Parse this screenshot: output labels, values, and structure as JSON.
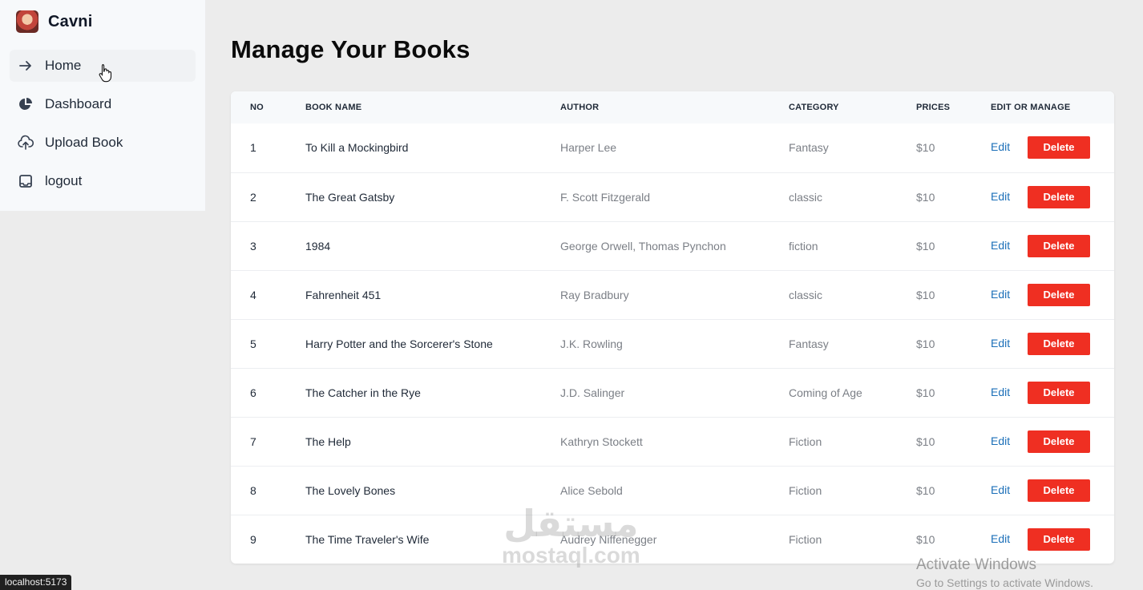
{
  "brand": {
    "name": "Cavni"
  },
  "sidebar": {
    "items": [
      {
        "label": "Home",
        "icon": "arrow-right-icon",
        "active": true
      },
      {
        "label": "Dashboard",
        "icon": "pie-chart-icon",
        "active": false
      },
      {
        "label": "Upload Book",
        "icon": "cloud-upload-icon",
        "active": false
      },
      {
        "label": "logout",
        "icon": "inbox-icon",
        "active": false
      }
    ]
  },
  "page": {
    "title": "Manage Your Books"
  },
  "table": {
    "headers": [
      "NO",
      "BOOK NAME",
      "AUTHOR",
      "CATEGORY",
      "PRICES",
      "EDIT OR MANAGE"
    ],
    "edit_label": "Edit",
    "delete_label": "Delete",
    "rows": [
      {
        "no": "1",
        "name": "To Kill a Mockingbird",
        "author": "Harper Lee",
        "category": "Fantasy",
        "price": "$10"
      },
      {
        "no": "2",
        "name": "The Great Gatsby",
        "author": "F. Scott Fitzgerald",
        "category": "classic",
        "price": "$10"
      },
      {
        "no": "3",
        "name": "1984",
        "author": "George Orwell, Thomas Pynchon",
        "category": "fiction",
        "price": "$10"
      },
      {
        "no": "4",
        "name": "Fahrenheit 451",
        "author": "Ray Bradbury",
        "category": "classic",
        "price": "$10"
      },
      {
        "no": "5",
        "name": "Harry Potter and the Sorcerer's Stone",
        "author": "J.K. Rowling",
        "category": "Fantasy",
        "price": "$10"
      },
      {
        "no": "6",
        "name": "The Catcher in the Rye",
        "author": "J.D. Salinger",
        "category": "Coming of Age",
        "price": "$10"
      },
      {
        "no": "7",
        "name": "The Help",
        "author": "Kathryn Stockett",
        "category": "Fiction",
        "price": "$10"
      },
      {
        "no": "8",
        "name": "The Lovely Bones",
        "author": "Alice Sebold",
        "category": "Fiction",
        "price": "$10"
      },
      {
        "no": "9",
        "name": "The Time Traveler's Wife",
        "author": "Audrey Niffenegger",
        "category": "Fiction",
        "price": "$10"
      }
    ]
  },
  "status_bar": {
    "url": "localhost:5173"
  },
  "watermark": {
    "arabic": "مستقل",
    "latin": "mostaql.com"
  },
  "os_notice": {
    "line1": "Activate Windows",
    "line2": "Go to Settings to activate Windows."
  },
  "colors": {
    "delete": "#ef2f22",
    "edit": "#1b6fb8",
    "sidebar_bg": "#f7f9fb",
    "page_bg": "#ececec"
  }
}
